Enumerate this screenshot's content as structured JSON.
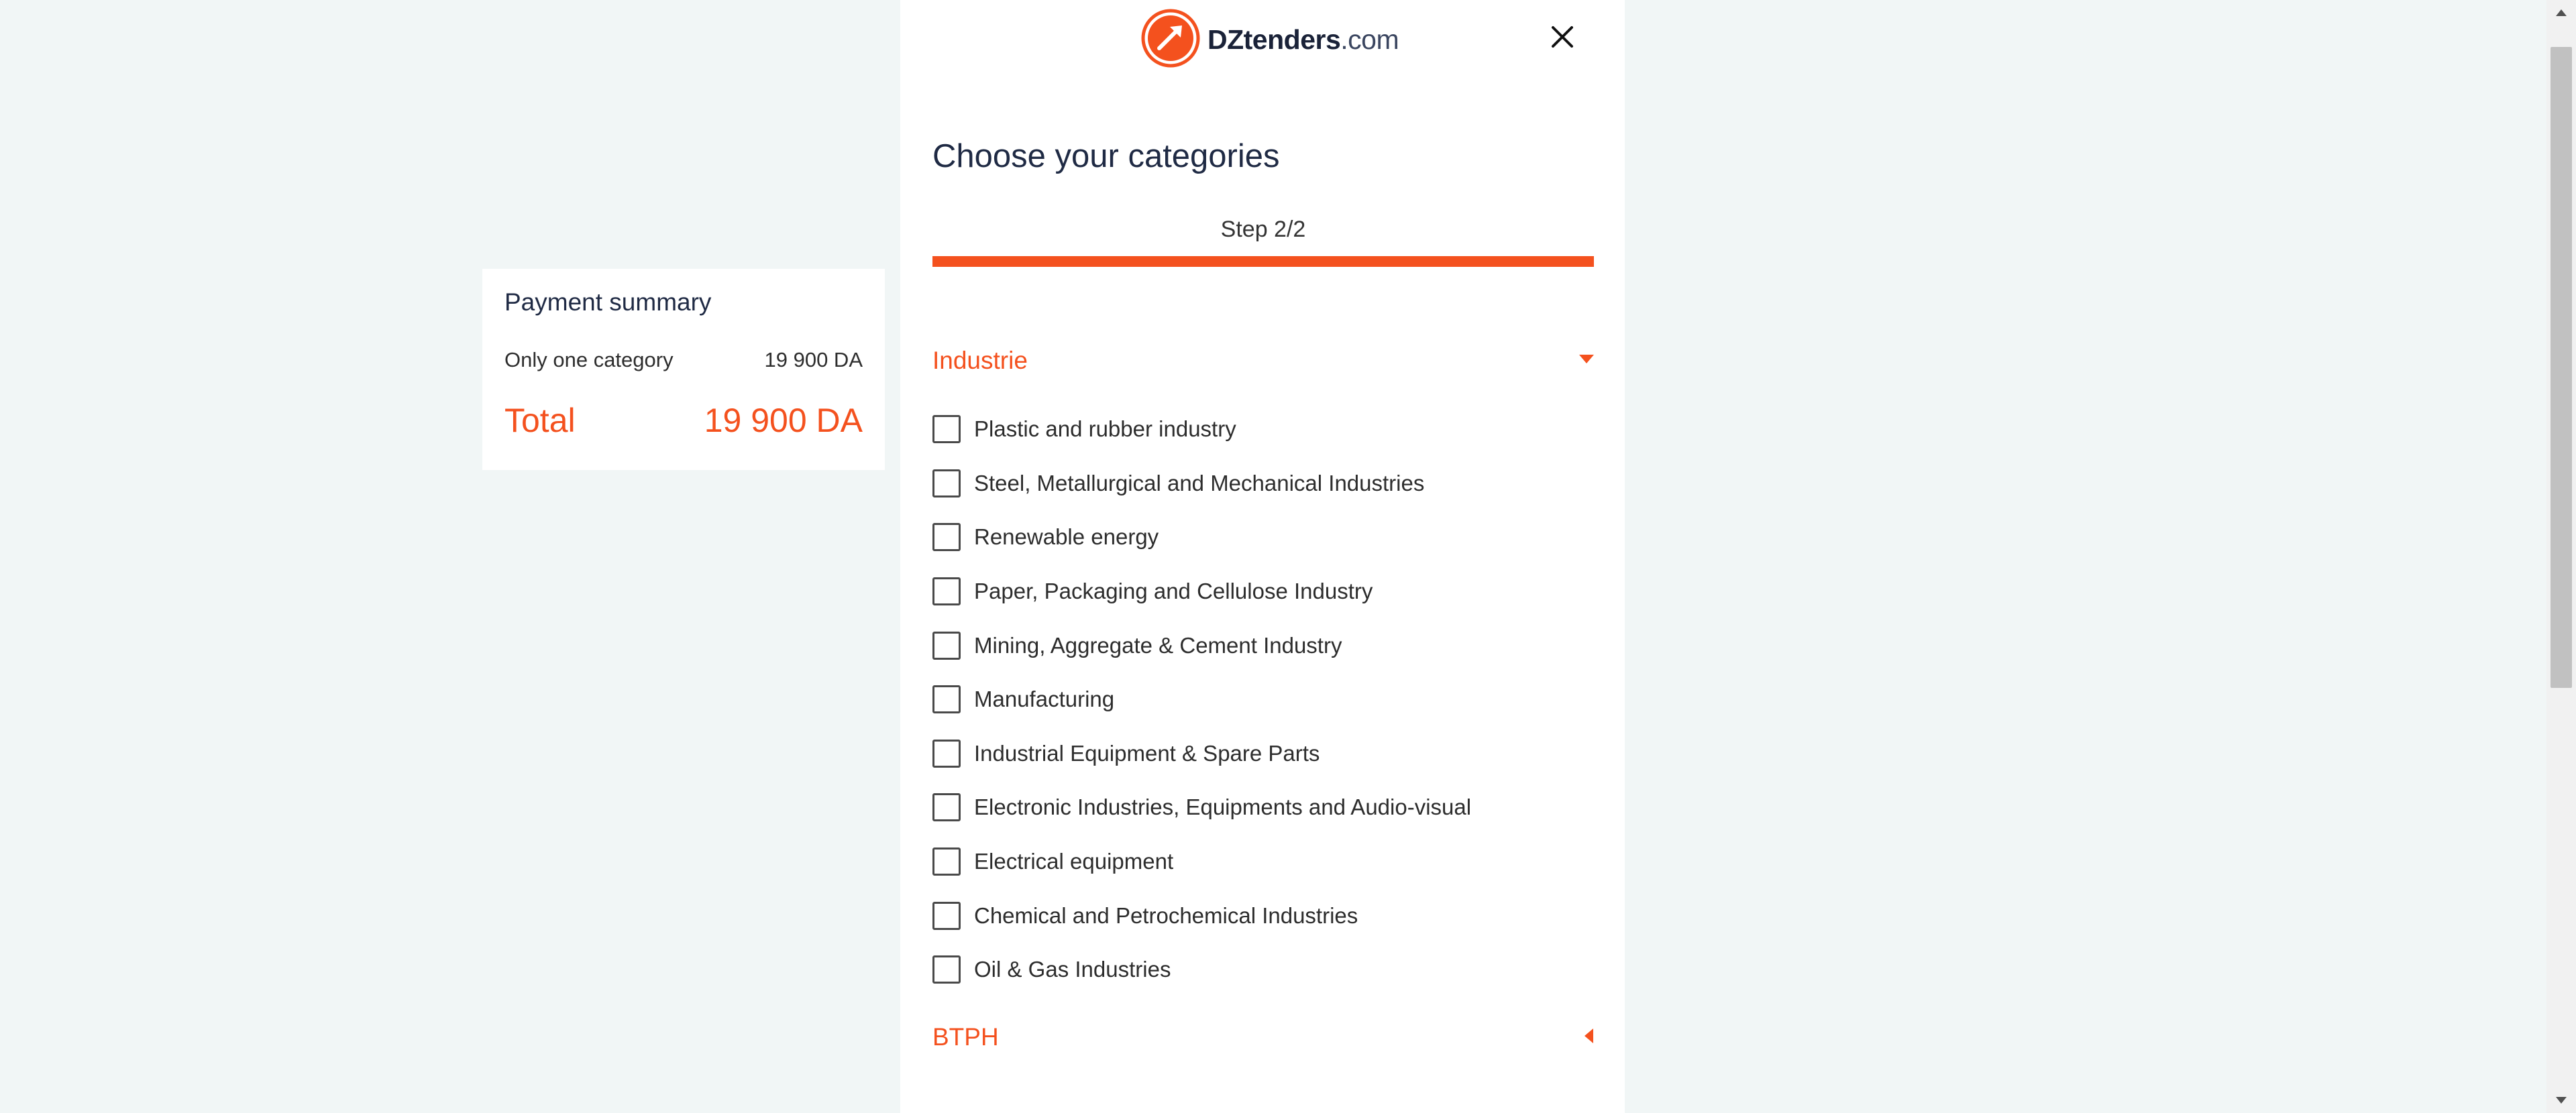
{
  "header": {
    "logo_brand": "DZtenders",
    "logo_tld": ".com",
    "close_label": "×"
  },
  "page": {
    "title": "Choose your categories",
    "step": "Step 2/2",
    "progress_percent": 100
  },
  "categories": [
    {
      "name": "Industrie",
      "expanded": true,
      "items": [
        "Plastic and rubber industry",
        "Steel, Metallurgical and Mechanical Industries",
        "Renewable energy",
        "Paper, Packaging and Cellulose Industry",
        "Mining, Aggregate & Cement Industry",
        "Manufacturing",
        "Industrial Equipment & Spare Parts",
        "Electronic Industries, Equipments and Audio-visual",
        "Electrical equipment",
        "Chemical and Petrochemical Industries",
        "Oil & Gas Industries"
      ]
    },
    {
      "name": "BTPH",
      "expanded": false,
      "items": []
    }
  ],
  "summary": {
    "title": "Payment summary",
    "line_label": "Only one category",
    "line_value": "19 900 DA",
    "total_label": "Total",
    "total_value": "19 900 DA"
  },
  "colors": {
    "accent": "#f4511e",
    "background": "#f1f6f6",
    "text_dark": "#1f2a44"
  }
}
